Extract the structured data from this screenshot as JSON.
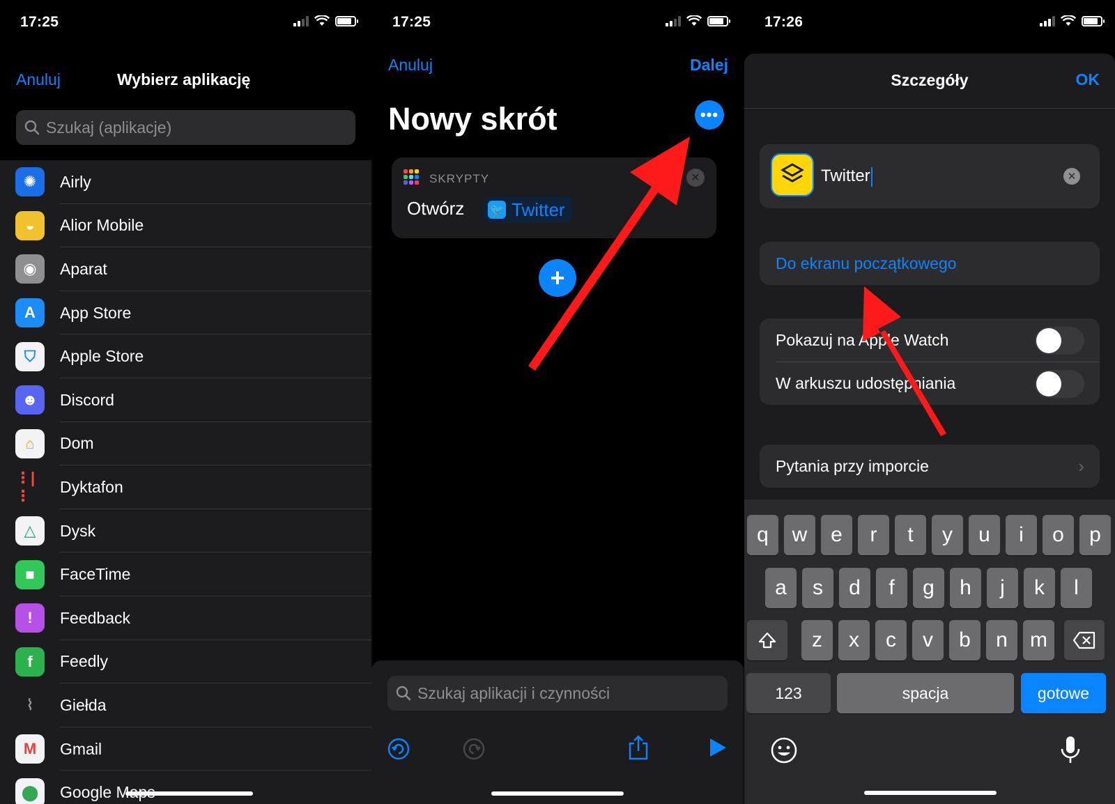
{
  "screen1": {
    "status_time": "17:25",
    "cancel": "Anuluj",
    "title": "Wybierz aplikację",
    "search_placeholder": "Szukaj (aplikacje)",
    "apps": [
      {
        "name": "Airly",
        "icon": "airly-icon",
        "color": "#1a6fe8"
      },
      {
        "name": "Alior Mobile",
        "icon": "alior-icon",
        "color": "#f2c12e"
      },
      {
        "name": "Aparat",
        "icon": "camera-icon",
        "color": "#8e8e93"
      },
      {
        "name": "App Store",
        "icon": "app-store-icon",
        "color": "#1c8cf7"
      },
      {
        "name": "Apple Store",
        "icon": "apple-store-icon",
        "color": "#f2f2f7"
      },
      {
        "name": "Discord",
        "icon": "discord-icon",
        "color": "#5865f2"
      },
      {
        "name": "Dom",
        "icon": "home-icon",
        "color": "#f2f2f7"
      },
      {
        "name": "Dyktafon",
        "icon": "voice-memos-icon",
        "color": "#1c1c1e"
      },
      {
        "name": "Dysk",
        "icon": "drive-icon",
        "color": "#f2f2f7"
      },
      {
        "name": "FaceTime",
        "icon": "facetime-icon",
        "color": "#32c759"
      },
      {
        "name": "Feedback",
        "icon": "feedback-icon",
        "color": "#b750e6"
      },
      {
        "name": "Feedly",
        "icon": "feedly-icon",
        "color": "#2bb24c"
      },
      {
        "name": "Giełda",
        "icon": "stocks-icon",
        "color": "#1c1c1e"
      },
      {
        "name": "Gmail",
        "icon": "gmail-icon",
        "color": "#f2f2f7"
      },
      {
        "name": "Google Maps",
        "icon": "maps-icon",
        "color": "#f2f2f7"
      }
    ]
  },
  "screen2": {
    "status_time": "17:25",
    "cancel": "Anuluj",
    "next": "Dalej",
    "title": "Nowy skrót",
    "card_category": "SKRYPTY",
    "card_verb": "Otwórz",
    "card_app": "Twitter",
    "search_placeholder": "Szukaj aplikacji i czynności"
  },
  "screen3": {
    "status_time": "17:26",
    "title": "Szczegóły",
    "ok": "OK",
    "shortcut_name": "Twitter",
    "add_to_home": "Do ekranu początkowego",
    "show_on_watch": "Pokazuj na Apple Watch",
    "in_share_sheet": "W arkuszu udostępniania",
    "import_questions": "Pytania przy imporcie",
    "keyboard": {
      "row1": [
        "q",
        "w",
        "e",
        "r",
        "t",
        "y",
        "u",
        "i",
        "o",
        "p"
      ],
      "row2": [
        "a",
        "s",
        "d",
        "f",
        "g",
        "h",
        "j",
        "k",
        "l"
      ],
      "row3": [
        "z",
        "x",
        "c",
        "v",
        "b",
        "n",
        "m"
      ],
      "numbers": "123",
      "space": "spacja",
      "done": "gotowe"
    }
  },
  "colors": {
    "accent": "#0a84ff",
    "annotation_arrow": "#ff1a1a"
  }
}
